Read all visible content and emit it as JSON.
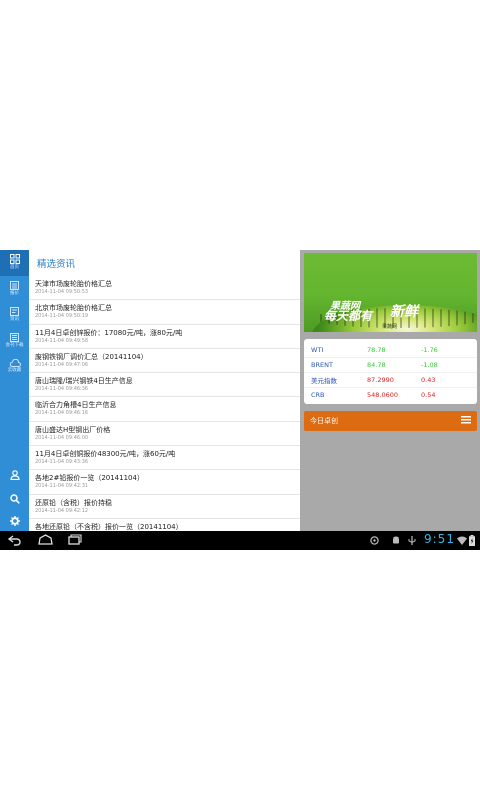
{
  "sidebar": {
    "items": [
      {
        "label": "首页",
        "icon": "grid-icon"
      },
      {
        "label": "报价",
        "icon": "list-icon"
      },
      {
        "label": "资讯",
        "icon": "document-icon"
      },
      {
        "label": "会刊下载",
        "icon": "book-icon"
      },
      {
        "label": "云收藏",
        "icon": "cloud-icon"
      }
    ],
    "bottom_icons": [
      "user-icon",
      "search-icon",
      "gear-icon"
    ]
  },
  "content": {
    "title": "精选资讯",
    "news": [
      {
        "title": "天津市场废轮胎价格汇总",
        "date": "2014-11-04 09:50:53"
      },
      {
        "title": "北京市场废轮胎价格汇总",
        "date": "2014-11-04 09:50:19"
      },
      {
        "title": "11月4日卓创锌报价：17080元/吨，涨80元/吨",
        "date": "2014-11-04 09:49:58"
      },
      {
        "title": "废钢铁钢厂调价汇总（20141104）",
        "date": "2014-11-04 09:47:06"
      },
      {
        "title": "唐山瑞隆/瑞兴钢铁4日生产信息",
        "date": "2014-11-04 09:46:36"
      },
      {
        "title": "临沂合力角槽4日生产信息",
        "date": "2014-11-04 09:46:16"
      },
      {
        "title": "唐山盛达H型钢出厂价格",
        "date": "2014-11-04 09:46:00"
      },
      {
        "title": "11月4日卓创铜报价48300元/吨，涨60元/吨",
        "date": "2014-11-04 09:43:36"
      },
      {
        "title": "各地2#铅报价一览（20141104）",
        "date": "2014-11-04 09:42:31"
      },
      {
        "title": "还原铅（含税）报价持稳",
        "date": "2014-11-04 09:42:12"
      },
      {
        "title": "各地还原铅（不含税）报价一览（20141104）",
        "date": ""
      }
    ]
  },
  "banner": {
    "line1": "果蔬网",
    "line2": "每天都有",
    "line3": "新鲜",
    "caption": "果蔬网"
  },
  "quotes": [
    {
      "name": "WTI",
      "value": "78.78",
      "change": "-1.76",
      "value_color": "#33cc33",
      "change_color": "#33cc33"
    },
    {
      "name": "BRENT",
      "value": "84.78",
      "change": "-1.08",
      "value_color": "#33cc33",
      "change_color": "#33cc33"
    },
    {
      "name": "美元指数",
      "value": "87.2990",
      "change": "0.43",
      "value_color": "#e02020",
      "change_color": "#e02020"
    },
    {
      "name": "CRB",
      "value": "548.0600",
      "change": "0.54",
      "value_color": "#e02020",
      "change_color": "#e02020"
    }
  ],
  "today": {
    "label": "今日卓创"
  },
  "system": {
    "time": "9:51"
  },
  "colors": {
    "sidebar": "#2f8ed6",
    "accent": "#2a7fc8",
    "orange": "#dc6b12"
  }
}
